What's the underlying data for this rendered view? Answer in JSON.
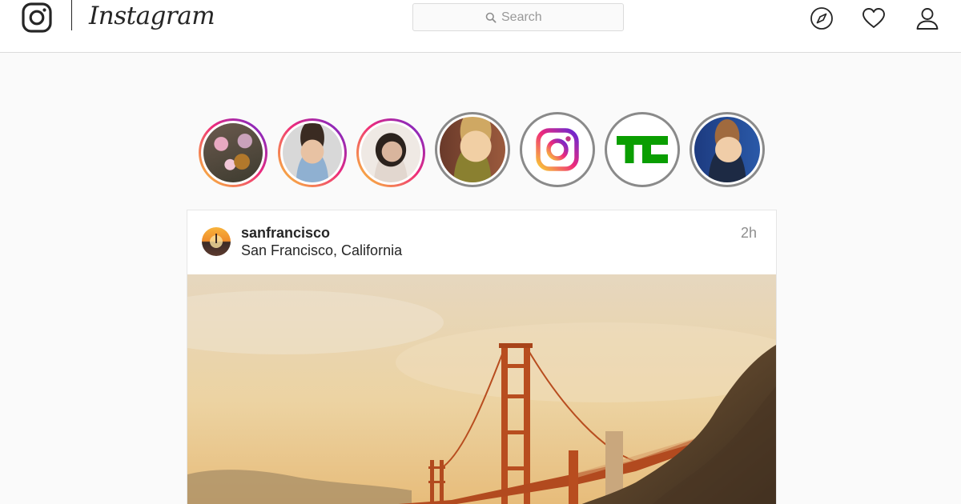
{
  "app": {
    "name": "Instagram"
  },
  "header": {
    "logo_icon": "instagram-glyph-icon",
    "wordmark": "Instagram",
    "search": {
      "placeholder": "Search",
      "value": "",
      "icon": "search-icon"
    },
    "nav": [
      {
        "name": "explore",
        "icon": "compass-icon"
      },
      {
        "name": "activity",
        "icon": "heart-icon"
      },
      {
        "name": "profile",
        "icon": "user-icon"
      }
    ]
  },
  "stories": [
    {
      "state": "unseen",
      "avatar": "flowers-lion-photo"
    },
    {
      "state": "unseen",
      "avatar": "bearded-man-photo"
    },
    {
      "state": "unseen",
      "avatar": "woman-portrait-photo"
    },
    {
      "state": "seen",
      "avatar": "young-man-photo"
    },
    {
      "state": "seen",
      "avatar": "instagram-logo"
    },
    {
      "state": "seen",
      "avatar": "techcrunch-logo",
      "logo_text": "TC"
    },
    {
      "state": "seen",
      "avatar": "smiling-man-photo"
    }
  ],
  "post": {
    "username": "sanfrancisco",
    "location": "San Francisco, California",
    "time": "2h",
    "image": "golden-gate-bridge-photo"
  },
  "colors": {
    "story_ring_start": "#f9ce34",
    "story_ring_mid": "#ee2a7b",
    "story_ring_end": "#6228d7",
    "seen_ring": "#8a8a8a",
    "techcrunch_green": "#0a9e01",
    "border": "#dbdbdb",
    "background": "#fafafa"
  }
}
